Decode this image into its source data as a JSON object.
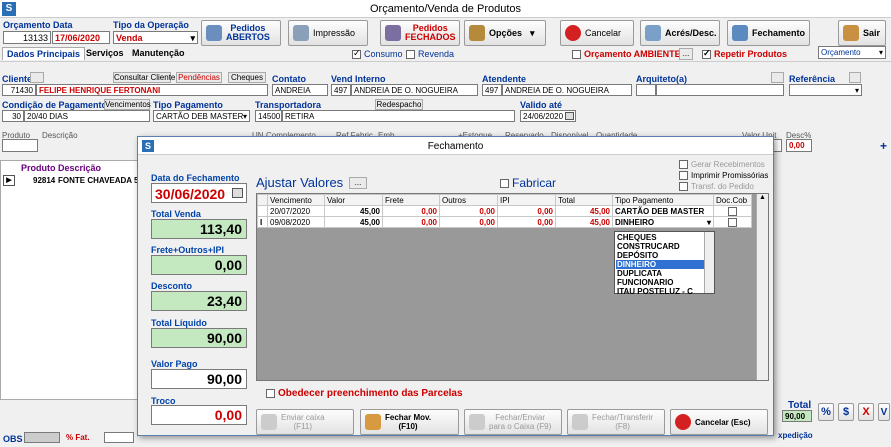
{
  "window": {
    "title": "Orçamento/Venda de Produtos",
    "logo": "S"
  },
  "header": {
    "orcamento_label": "Orçamento",
    "orcamento": "13133",
    "data_label": "Data",
    "data": "17/06/2020",
    "tipo_label": "Tipo da Operação",
    "tipo": "Venda"
  },
  "toolbar": {
    "pedidos_abertos": "Pedidos\nABERTOS",
    "impressao": "Impressão",
    "pedidos_fechados": "Pedidos\nFECHADOS",
    "opcoes": "Opções",
    "cancelar": "Cancelar",
    "acres": "Acrés/Desc.",
    "fechamento": "Fechamento",
    "sair": "Sair"
  },
  "tabs": {
    "dados": "Dados Principais",
    "servicos": "Serviços",
    "manutencao": "Manutenção"
  },
  "options": {
    "consumo": "Consumo",
    "revenda": "Revenda",
    "orc_ambiente": "Orçamento AMBIENTE",
    "dots": "...",
    "repetir": "Repetir Produtos",
    "tipo_select": "Orçamento"
  },
  "cliente": {
    "label": "Cliente",
    "btn_consultar": "Consultar Cliente",
    "btn_pendencias": "Pendências",
    "btn_cheques": "Cheques",
    "codigo": "71430",
    "nome": "FELIPE HENRIQUE FERTONANI"
  },
  "contato": {
    "label": "Contato",
    "value": "ANDREIA"
  },
  "vend": {
    "label": "Vend Interno",
    "codigo": "497",
    "nome": "ANDREIA DE O. NOGUEIRA"
  },
  "atendente": {
    "label": "Atendente",
    "codigo": "497",
    "nome": "ANDREIA DE O. NOGUEIRA"
  },
  "arquiteto": {
    "label": "Arquiteto(a)"
  },
  "referencia": {
    "label": "Referência"
  },
  "condicao": {
    "label": "Condição de Pagamento",
    "btn": "Vencimentos",
    "codigo": "30",
    "nome": "20/40 DIAS"
  },
  "tipo_pag": {
    "label": "Tipo Pagamento",
    "value": "CARTÃO DEB MASTER"
  },
  "transp": {
    "label": "Transportadora",
    "btn": "Redespacho",
    "codigo": "14500",
    "nome": "RETIRA"
  },
  "valido": {
    "label": "Valido até",
    "value": "24/06/2020"
  },
  "grid_headers": [
    "Produto",
    "Descrição",
    "UN",
    "Complemento",
    "Ref Fabric.",
    "Emb.",
    "+Estoque",
    "Reservado",
    "Disponível",
    "Quantidade",
    "Valor Unit",
    "Desc%"
  ],
  "produtos": {
    "headers": [
      "Produto",
      "Descrição"
    ],
    "rows": [
      {
        "codigo": "92814",
        "descricao": "FONTE CHAVEADA  5"
      }
    ]
  },
  "right_row": {
    "desc": "0,00"
  },
  "bottom": {
    "total_label": "Total",
    "total": "90,00",
    "obs": "OBS",
    "fat": "% Fat.",
    "expedicao": "xpedição",
    "pct": "%",
    "dollar": "$",
    "x": "X"
  },
  "dialog": {
    "title": "Fechamento",
    "data_label": "Data do Fechamento",
    "data": "30/06/2020",
    "total_venda_label": "Total Venda",
    "total_venda": "113,40",
    "frete_label": "Frete+Outros+IPI",
    "frete": "0,00",
    "desconto_label": "Desconto",
    "desconto": "23,40",
    "total_liq_label": "Total Líquido",
    "total_liq": "90,00",
    "valor_pago_label": "Valor Pago",
    "valor_pago": "90,00",
    "troco_label": "Troco",
    "troco": "0,00",
    "ajustar": "Ajustar Valores",
    "ajustar_btn": "...",
    "fabricar": "Fabricar",
    "gerar": "Gerar Recebimentos",
    "imprimir": "Imprimir Promissórias",
    "transf": "Transf. do Pedido",
    "table_headers": [
      "Vencimento",
      "Valor",
      "Frete",
      "Outros",
      "IPI",
      "Total",
      "Tipo Pagamento",
      "Doc.Cob"
    ],
    "rows": [
      {
        "venc": "20/07/2020",
        "valor": "45,00",
        "frete": "0,00",
        "outros": "0,00",
        "ipi": "0,00",
        "total": "45,00",
        "tipo": "CARTÃO DEB MASTER"
      },
      {
        "venc": "09/08/2020",
        "valor": "45,00",
        "frete": "0,00",
        "outros": "0,00",
        "ipi": "0,00",
        "total": "45,00",
        "tipo": "DINHEIRO"
      }
    ],
    "dropdown": [
      "CHEQUES",
      "CONSTRUCARD",
      "DEPÓSITO",
      "DINHEIRO",
      "DUPLICATA",
      "FUNCIONARIO",
      "ITAU POSTELUZ - C"
    ],
    "dropdown_selected": "DINHEIRO",
    "obedecer": "Obedecer preenchimento das Parcelas",
    "btn_enviar": "Enviar caixa\n(F11)",
    "btn_fechar": "Fechar Mov.\n(F10)",
    "btn_fechar_enviar": "Fechar/Enviar\npara o Caixa (F9)",
    "btn_transferir": "Fechar/Transferir\n(F8)",
    "btn_cancelar": "Cancelar (Esc)"
  },
  "colors": {
    "label_blue": "#003399",
    "red": "#cc0000",
    "green_field": "#c4e8c0"
  }
}
